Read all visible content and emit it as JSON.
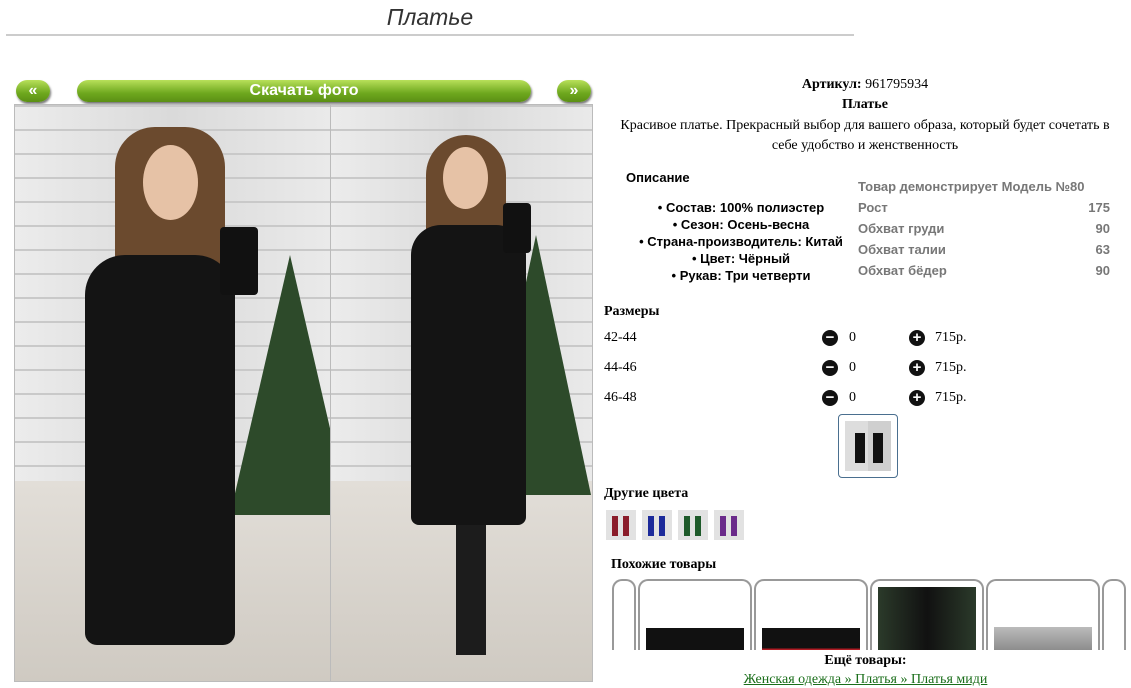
{
  "title": "Платье",
  "gallery": {
    "prev_label": "«",
    "next_label": "»",
    "download_label": "Скачать фото"
  },
  "product": {
    "article_label": "Артикул:",
    "article_value": "961795934",
    "name": "Платье",
    "description": "Красивое платье. Прекрасный выбор для вашего образа, который будет сочетать в себе удобство и женственность"
  },
  "description_section": {
    "heading": "Описание",
    "items": [
      "Состав: 100% полиэстер",
      "Сезон: Осень-весна",
      "Страна-производитель: Китай",
      "Цвет: Чёрный",
      "Рукав: Три четверти"
    ]
  },
  "model": {
    "heading": "Товар демонстрирует Модель №80",
    "rows": [
      {
        "label": "Рост",
        "value": "175"
      },
      {
        "label": "Обхват груди",
        "value": "90"
      },
      {
        "label": "Обхват талии",
        "value": "63"
      },
      {
        "label": "Обхват бёдер",
        "value": "90"
      }
    ]
  },
  "sizes": {
    "heading": "Размеры",
    "rows": [
      {
        "label": "42-44",
        "qty": "0",
        "price": "715р."
      },
      {
        "label": "44-46",
        "qty": "0",
        "price": "715р."
      },
      {
        "label": "46-48",
        "qty": "0",
        "price": "715р."
      }
    ],
    "minus_icon": "minus-circle-icon",
    "plus_icon": "plus-circle-icon"
  },
  "other_colors": {
    "heading": "Другие цвета",
    "swatches": [
      "#8a1c2a",
      "#1c2a9a",
      "#1e5a2a",
      "#6a2a8a"
    ]
  },
  "similar": {
    "heading": "Похожие товары"
  },
  "more": {
    "heading": "Ещё товары:",
    "breadcrumb": "Женская одежда » Платья » Платья миди"
  },
  "colors": {
    "accent_green": "#6ea81e",
    "link_green": "#1a6e1a"
  }
}
